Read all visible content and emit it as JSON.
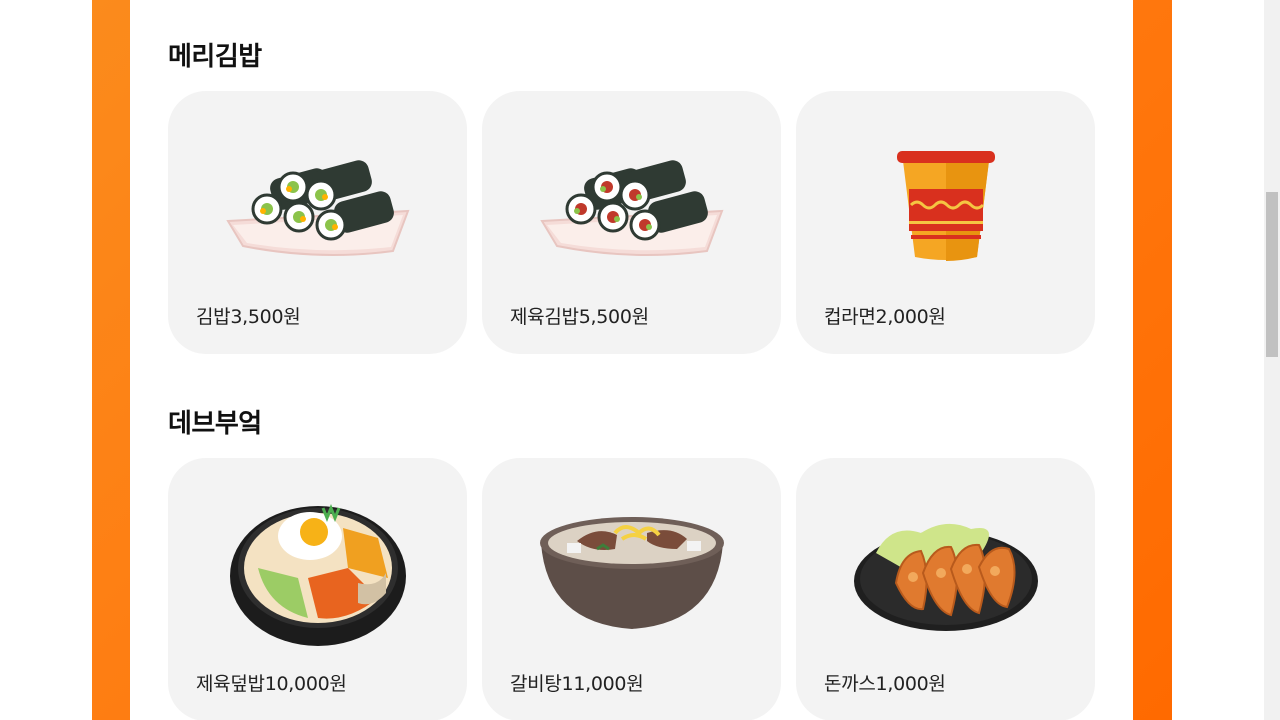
{
  "sections": [
    {
      "title": "메리김밥",
      "items": [
        {
          "label": "김밥3,500원",
          "icon": "gimbap-icon"
        },
        {
          "label": "제육김밥5,500원",
          "icon": "gimbap-icon"
        },
        {
          "label": "컵라면2,000원",
          "icon": "cup-ramen-icon"
        }
      ]
    },
    {
      "title": "데브부엌",
      "items": [
        {
          "label": "제육덮밥10,000원",
          "icon": "bibimbap-icon"
        },
        {
          "label": "갈비탕11,000원",
          "icon": "galbitang-icon"
        },
        {
          "label": "돈까스1,000원",
          "icon": "tonkatsu-icon"
        }
      ]
    }
  ],
  "colors": {
    "frame": "#ff7a10",
    "card": "#f3f3f3"
  }
}
